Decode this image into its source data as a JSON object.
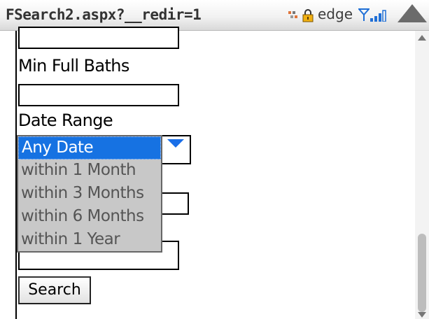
{
  "titlebar": {
    "url": "FSearch2.aspx?__redir=1",
    "network": "edge",
    "icons": [
      "connection-icon",
      "lock-icon",
      "antenna-icon",
      "signal-bars-icon",
      "up-arrow-icon"
    ]
  },
  "form": {
    "min_full_baths_label": "Min Full Baths",
    "min_full_baths_value": "",
    "date_range_label": "Date Range",
    "date_range_options": [
      "Any Date",
      "within 1 Month",
      "within 3 Months",
      "within 6 Months",
      "within 1 Year"
    ],
    "date_range_selected": "Any Date",
    "search_label": "Search"
  },
  "colors": {
    "selected_bg": "#1672e2",
    "list_bg": "#c8c8c8",
    "arrow": "#1a6fe8"
  }
}
